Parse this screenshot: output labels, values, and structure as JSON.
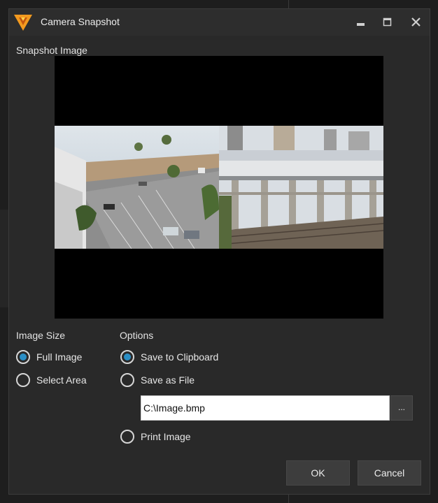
{
  "window": {
    "title": "Camera Snapshot",
    "controls": {
      "minimize": "minimize-icon",
      "maximize": "maximize-icon",
      "close": "close-icon"
    }
  },
  "snapshot": {
    "label": "Snapshot Image"
  },
  "image_size": {
    "label": "Image Size",
    "options": [
      {
        "label": "Full Image",
        "checked": true
      },
      {
        "label": "Select Area",
        "checked": false
      }
    ]
  },
  "options": {
    "label": "Options",
    "save_clipboard": {
      "label": "Save to Clipboard",
      "checked": true
    },
    "save_file": {
      "label": "Save as File",
      "checked": false
    },
    "file_path": "C:\\Image.bmp",
    "browse_label": "...",
    "print": {
      "label": "Print Image",
      "checked": false
    }
  },
  "buttons": {
    "ok": "OK",
    "cancel": "Cancel"
  },
  "colors": {
    "accent": "#2b8fc6",
    "logo_orange": "#f39a1f",
    "background": "#292929"
  }
}
